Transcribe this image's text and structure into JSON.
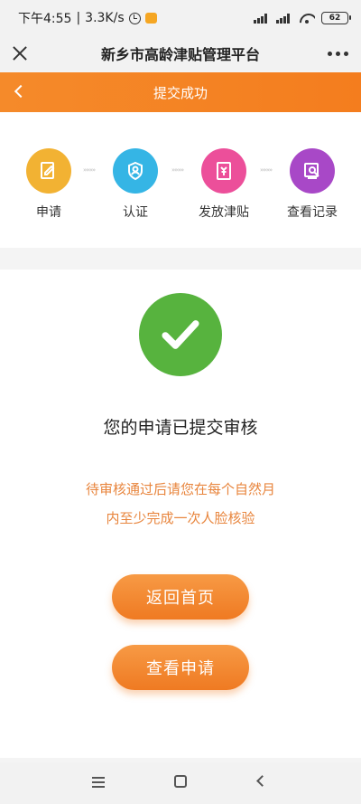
{
  "status_bar": {
    "time": "下午4:55",
    "speed": "3.3K/s",
    "battery": "62"
  },
  "header": {
    "title": "新乡市高龄津贴管理平台"
  },
  "nav": {
    "title": "提交成功"
  },
  "steps": [
    {
      "label": "申请",
      "color": "#f2b233",
      "icon": "edit-icon"
    },
    {
      "label": "认证",
      "color": "#35b5e5",
      "icon": "shield-user-icon"
    },
    {
      "label": "发放津贴",
      "color": "#ec4f9a",
      "icon": "money-card-icon"
    },
    {
      "label": "查看记录",
      "color": "#a848c7",
      "icon": "record-search-icon"
    }
  ],
  "step_arrow": "»»»»",
  "result": {
    "title": "您的申请已提交审核",
    "notice_line1": "待审核通过后请您在每个自然月",
    "notice_line2": "内至少完成一次人脸核验"
  },
  "buttons": {
    "home": "返回首页",
    "view": "查看申请"
  },
  "colors": {
    "accent": "#f58a2a",
    "success": "#57b33e",
    "notice": "#e8853d"
  }
}
